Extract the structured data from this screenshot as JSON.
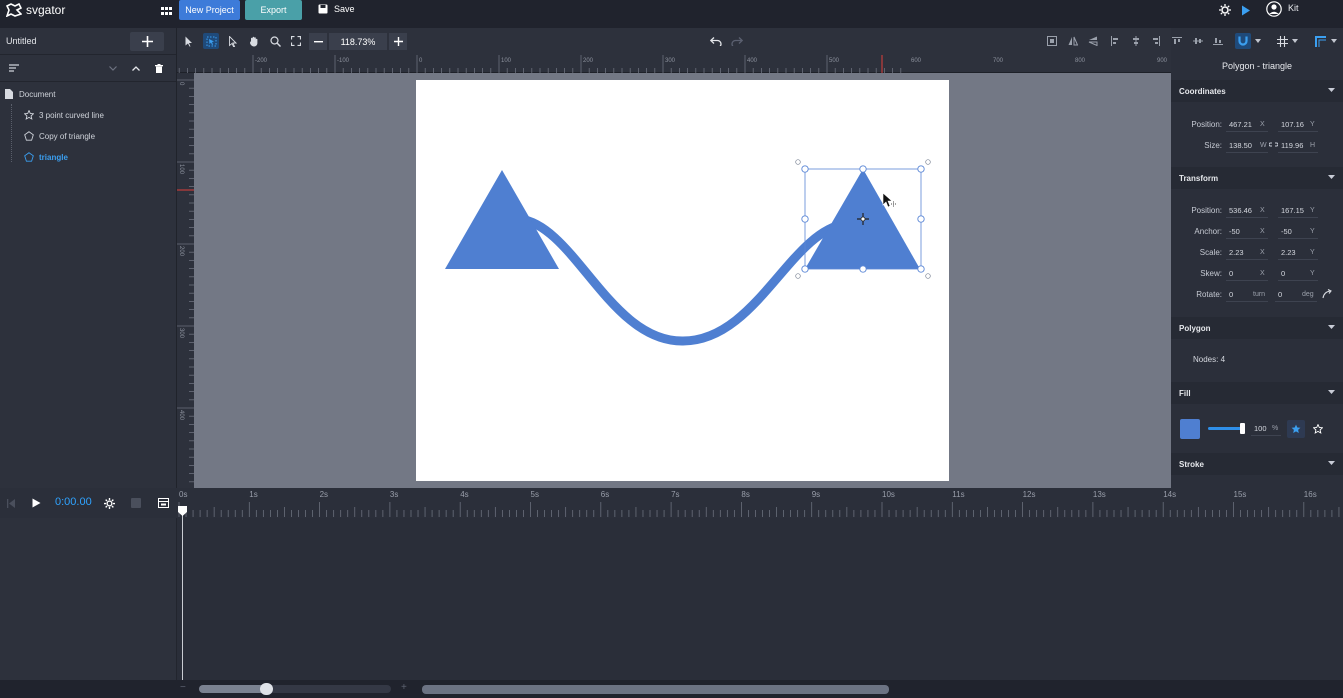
{
  "app": {
    "logo_text": "svgator",
    "new_project_label": "New Project",
    "export_label": "Export",
    "save_label": "Save",
    "user_name": "Kit"
  },
  "project": {
    "title": "Untitled"
  },
  "layers": {
    "root": "Document",
    "items": [
      {
        "label": "3 point curved line",
        "icon": "star-icon",
        "selected": false
      },
      {
        "label": "Copy of triangle",
        "icon": "pentagon-icon",
        "selected": false
      },
      {
        "label": "triangle",
        "icon": "pentagon-icon",
        "selected": true
      }
    ]
  },
  "toolbar": {
    "zoom": "118.73%"
  },
  "rulers": {
    "h_labels": [
      "-200",
      "-100",
      "0",
      "100",
      "200",
      "300",
      "400",
      "500",
      "600",
      "700",
      "800",
      "900"
    ],
    "v_labels": [
      "0",
      "100",
      "200",
      "300",
      "400",
      "500"
    ]
  },
  "inspector": {
    "title": "Polygon - triangle",
    "coordinates": {
      "heading": "Coordinates",
      "position_label": "Position:",
      "pos_x": "467.21",
      "pos_x_unit": "X",
      "pos_y": "107.16",
      "pos_y_unit": "Y",
      "size_label": "Size:",
      "width": "138.50",
      "width_unit": "W",
      "height": "119.96",
      "height_unit": "H"
    },
    "transform": {
      "heading": "Transform",
      "position_label": "Position:",
      "pos_x": "536.46",
      "pos_x_unit": "X",
      "pos_y": "167.15",
      "pos_y_unit": "Y",
      "anchor_label": "Anchor:",
      "anchor_x": "-50",
      "anchor_x_unit": "X",
      "anchor_y": "-50",
      "anchor_y_unit": "Y",
      "scale_label": "Scale:",
      "scale_x": "2.23",
      "scale_x_unit": "X",
      "scale_y": "2.23",
      "scale_y_unit": "Y",
      "skew_label": "Skew:",
      "skew_x": "0",
      "skew_x_unit": "X",
      "skew_y": "0",
      "skew_y_unit": "Y",
      "rotate_label": "Rotate:",
      "rotate_turn": "0",
      "rotate_turn_unit": "turn",
      "rotate_deg": "0",
      "rotate_deg_unit": "deg"
    },
    "polygon": {
      "heading": "Polygon",
      "nodes": "Nodes: 4"
    },
    "fill": {
      "heading": "Fill",
      "opacity": "100",
      "opacity_unit": "%",
      "color": "#4f7fd1"
    },
    "stroke": {
      "heading": "Stroke"
    }
  },
  "timeline": {
    "time": "0:00.00",
    "ticks": [
      "0s",
      "1s",
      "2s",
      "3s",
      "4s",
      "5s",
      "6s",
      "7s",
      "8s",
      "9s",
      "10s",
      "11s",
      "12s",
      "13s",
      "14s",
      "15s",
      "16s"
    ]
  },
  "colors": {
    "accent": "#3b8ef0",
    "new_project": "#3d7bd9",
    "export": "#4aa0a8",
    "shape_fill": "#4f7fd1",
    "selection": "#3f7fe0"
  }
}
